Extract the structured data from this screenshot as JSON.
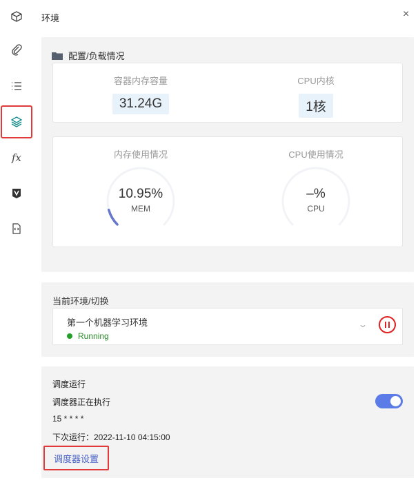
{
  "header": {
    "title": "环境",
    "close_glyph": "×"
  },
  "rail": [
    {
      "icon": "cube-icon"
    },
    {
      "icon": "paperclip-icon"
    },
    {
      "icon": "list-icon"
    },
    {
      "icon": "layers-icon",
      "active": true
    },
    {
      "icon": "fx-icon",
      "label": "fx"
    },
    {
      "icon": "v-badge-icon"
    },
    {
      "icon": "code-file-icon"
    }
  ],
  "config": {
    "title": "配置/负载情况",
    "container_memory_label": "容器内存容量",
    "container_memory_value": "31.24G",
    "cpu_cores_label": "CPU内核",
    "cpu_cores_value": "1核",
    "memory_usage_label": "内存使用情况",
    "memory_usage_value": "10.95%",
    "memory_usage_fraction": 0.1095,
    "memory_unit": "MEM",
    "cpu_usage_label": "CPU使用情况",
    "cpu_usage_value": "–%",
    "cpu_unit": "CPU"
  },
  "environment": {
    "title": "当前环境/切换",
    "selected_name": "第一个机器学习环境",
    "status": "Running",
    "status_color": "#22a02a"
  },
  "scheduler": {
    "title": "调度运行",
    "status": "调度器正在执行",
    "enabled": true,
    "cron": "15 * * * *",
    "next_run": "下次运行：2022-11-10 04:15:00",
    "settings_link": "调度器设置",
    "accent_color": "#5b7be6"
  }
}
